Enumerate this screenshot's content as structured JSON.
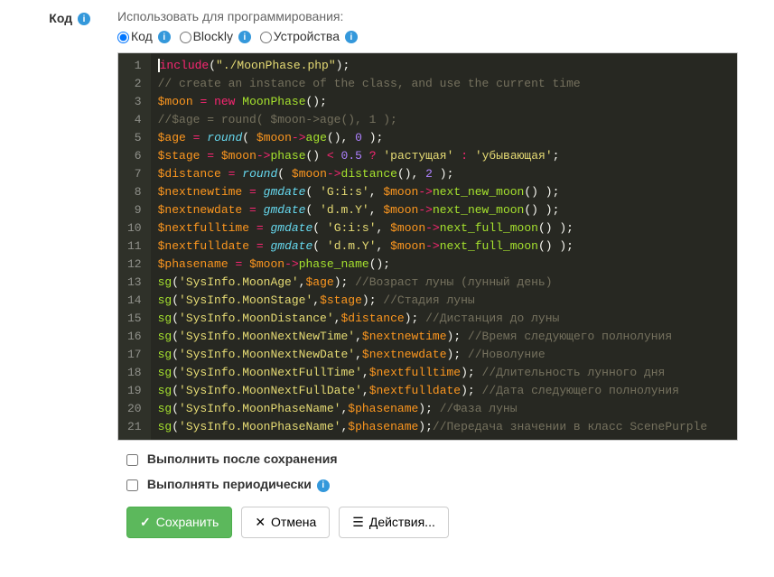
{
  "label": "Код",
  "hint": "Использовать для программирования:",
  "radios": {
    "code": "Код",
    "blockly": "Blockly",
    "devices": "Устройства"
  },
  "code_lines": [
    [
      [
        "k-red",
        "include"
      ],
      [
        "k-white",
        "("
      ],
      [
        "k-yellow",
        "\"./MoonPhase.php\""
      ],
      [
        "k-white",
        ");"
      ]
    ],
    [
      [
        "k-comment",
        "// create an instance of the class, and use the current time"
      ]
    ],
    [
      [
        "k-orange",
        "$moon"
      ],
      [
        "k-white",
        " "
      ],
      [
        "k-red",
        "="
      ],
      [
        "k-white",
        " "
      ],
      [
        "k-red",
        "new"
      ],
      [
        "k-white",
        " "
      ],
      [
        "k-green",
        "MoonPhase"
      ],
      [
        "k-white",
        "();"
      ]
    ],
    [
      [
        "k-comment",
        "//$age = round( $moon->age(), 1 );"
      ]
    ],
    [
      [
        "k-orange",
        "$age"
      ],
      [
        "k-white",
        " "
      ],
      [
        "k-red",
        "="
      ],
      [
        "k-white",
        " "
      ],
      [
        "k-blue",
        "round"
      ],
      [
        "k-white",
        "( "
      ],
      [
        "k-orange",
        "$moon"
      ],
      [
        "k-red",
        "->"
      ],
      [
        "k-green",
        "age"
      ],
      [
        "k-white",
        "(), "
      ],
      [
        "k-purple",
        "0"
      ],
      [
        "k-white",
        " );"
      ]
    ],
    [
      [
        "k-orange",
        "$stage"
      ],
      [
        "k-white",
        " "
      ],
      [
        "k-red",
        "="
      ],
      [
        "k-white",
        " "
      ],
      [
        "k-orange",
        "$moon"
      ],
      [
        "k-red",
        "->"
      ],
      [
        "k-green",
        "phase"
      ],
      [
        "k-white",
        "() "
      ],
      [
        "k-red",
        "<"
      ],
      [
        "k-white",
        " "
      ],
      [
        "k-purple",
        "0.5"
      ],
      [
        "k-white",
        " "
      ],
      [
        "k-red",
        "?"
      ],
      [
        "k-white",
        " "
      ],
      [
        "k-yellow",
        "'растущая'"
      ],
      [
        "k-white",
        " "
      ],
      [
        "k-red",
        ":"
      ],
      [
        "k-white",
        " "
      ],
      [
        "k-yellow",
        "'убывающая'"
      ],
      [
        "k-white",
        ";"
      ]
    ],
    [
      [
        "k-orange",
        "$distance"
      ],
      [
        "k-white",
        " "
      ],
      [
        "k-red",
        "="
      ],
      [
        "k-white",
        " "
      ],
      [
        "k-blue",
        "round"
      ],
      [
        "k-white",
        "( "
      ],
      [
        "k-orange",
        "$moon"
      ],
      [
        "k-red",
        "->"
      ],
      [
        "k-green",
        "distance"
      ],
      [
        "k-white",
        "(), "
      ],
      [
        "k-purple",
        "2"
      ],
      [
        "k-white",
        " );"
      ]
    ],
    [
      [
        "k-orange",
        "$nextnewtime"
      ],
      [
        "k-white",
        " "
      ],
      [
        "k-red",
        "="
      ],
      [
        "k-white",
        " "
      ],
      [
        "k-blue",
        "gmdate"
      ],
      [
        "k-white",
        "( "
      ],
      [
        "k-yellow",
        "'G:i:s'"
      ],
      [
        "k-white",
        ", "
      ],
      [
        "k-orange",
        "$moon"
      ],
      [
        "k-red",
        "->"
      ],
      [
        "k-green",
        "next_new_moon"
      ],
      [
        "k-white",
        "() );"
      ]
    ],
    [
      [
        "k-orange",
        "$nextnewdate"
      ],
      [
        "k-white",
        " "
      ],
      [
        "k-red",
        "="
      ],
      [
        "k-white",
        " "
      ],
      [
        "k-blue",
        "gmdate"
      ],
      [
        "k-white",
        "( "
      ],
      [
        "k-yellow",
        "'d.m.Y'"
      ],
      [
        "k-white",
        ", "
      ],
      [
        "k-orange",
        "$moon"
      ],
      [
        "k-red",
        "->"
      ],
      [
        "k-green",
        "next_new_moon"
      ],
      [
        "k-white",
        "() );"
      ]
    ],
    [
      [
        "k-orange",
        "$nextfulltime"
      ],
      [
        "k-white",
        " "
      ],
      [
        "k-red",
        "="
      ],
      [
        "k-white",
        " "
      ],
      [
        "k-blue",
        "gmdate"
      ],
      [
        "k-white",
        "( "
      ],
      [
        "k-yellow",
        "'G:i:s'"
      ],
      [
        "k-white",
        ", "
      ],
      [
        "k-orange",
        "$moon"
      ],
      [
        "k-red",
        "->"
      ],
      [
        "k-green",
        "next_full_moon"
      ],
      [
        "k-white",
        "() );"
      ]
    ],
    [
      [
        "k-orange",
        "$nextfulldate"
      ],
      [
        "k-white",
        " "
      ],
      [
        "k-red",
        "="
      ],
      [
        "k-white",
        " "
      ],
      [
        "k-blue",
        "gmdate"
      ],
      [
        "k-white",
        "( "
      ],
      [
        "k-yellow",
        "'d.m.Y'"
      ],
      [
        "k-white",
        ", "
      ],
      [
        "k-orange",
        "$moon"
      ],
      [
        "k-red",
        "->"
      ],
      [
        "k-green",
        "next_full_moon"
      ],
      [
        "k-white",
        "() );"
      ]
    ],
    [
      [
        "k-orange",
        "$phasename"
      ],
      [
        "k-white",
        " "
      ],
      [
        "k-red",
        "="
      ],
      [
        "k-white",
        " "
      ],
      [
        "k-orange",
        "$moon"
      ],
      [
        "k-red",
        "->"
      ],
      [
        "k-green",
        "phase_name"
      ],
      [
        "k-white",
        "();"
      ]
    ],
    [
      [
        "k-green",
        "sg"
      ],
      [
        "k-white",
        "("
      ],
      [
        "k-yellow",
        "'SysInfo.MoonAge'"
      ],
      [
        "k-white",
        ","
      ],
      [
        "k-orange",
        "$age"
      ],
      [
        "k-white",
        "); "
      ],
      [
        "k-comment",
        "//Возраст луны (лунный день)"
      ]
    ],
    [
      [
        "k-green",
        "sg"
      ],
      [
        "k-white",
        "("
      ],
      [
        "k-yellow",
        "'SysInfo.MoonStage'"
      ],
      [
        "k-white",
        ","
      ],
      [
        "k-orange",
        "$stage"
      ],
      [
        "k-white",
        "); "
      ],
      [
        "k-comment",
        "//Стадия луны"
      ]
    ],
    [
      [
        "k-green",
        "sg"
      ],
      [
        "k-white",
        "("
      ],
      [
        "k-yellow",
        "'SysInfo.MoonDistance'"
      ],
      [
        "k-white",
        ","
      ],
      [
        "k-orange",
        "$distance"
      ],
      [
        "k-white",
        "); "
      ],
      [
        "k-comment",
        "//Дистанция до луны"
      ]
    ],
    [
      [
        "k-green",
        "sg"
      ],
      [
        "k-white",
        "("
      ],
      [
        "k-yellow",
        "'SysInfo.MoonNextNewTime'"
      ],
      [
        "k-white",
        ","
      ],
      [
        "k-orange",
        "$nextnewtime"
      ],
      [
        "k-white",
        "); "
      ],
      [
        "k-comment",
        "//Время следующего полнолуния"
      ]
    ],
    [
      [
        "k-green",
        "sg"
      ],
      [
        "k-white",
        "("
      ],
      [
        "k-yellow",
        "'SysInfo.MoonNextNewDate'"
      ],
      [
        "k-white",
        ","
      ],
      [
        "k-orange",
        "$nextnewdate"
      ],
      [
        "k-white",
        "); "
      ],
      [
        "k-comment",
        "//Новолуние"
      ]
    ],
    [
      [
        "k-green",
        "sg"
      ],
      [
        "k-white",
        "("
      ],
      [
        "k-yellow",
        "'SysInfo.MoonNextFullTime'"
      ],
      [
        "k-white",
        ","
      ],
      [
        "k-orange",
        "$nextfulltime"
      ],
      [
        "k-white",
        "); "
      ],
      [
        "k-comment",
        "//Длительность лунного дня"
      ]
    ],
    [
      [
        "k-green",
        "sg"
      ],
      [
        "k-white",
        "("
      ],
      [
        "k-yellow",
        "'SysInfo.MoonNextFullDate'"
      ],
      [
        "k-white",
        ","
      ],
      [
        "k-orange",
        "$nextfulldate"
      ],
      [
        "k-white",
        "); "
      ],
      [
        "k-comment",
        "//Дата следующего полнолуния"
      ]
    ],
    [
      [
        "k-green",
        "sg"
      ],
      [
        "k-white",
        "("
      ],
      [
        "k-yellow",
        "'SysInfo.MoonPhaseName'"
      ],
      [
        "k-white",
        ","
      ],
      [
        "k-orange",
        "$phasename"
      ],
      [
        "k-white",
        "); "
      ],
      [
        "k-comment",
        "//Фаза луны"
      ]
    ],
    [
      [
        "k-green",
        "sg"
      ],
      [
        "k-white",
        "("
      ],
      [
        "k-yellow",
        "'SysInfo.MoonPhaseName'"
      ],
      [
        "k-white",
        ","
      ],
      [
        "k-orange",
        "$phasename"
      ],
      [
        "k-white",
        ");"
      ],
      [
        "k-comment",
        "//Передача значении в класс ScenePurple"
      ]
    ]
  ],
  "checkboxes": {
    "run_after_save": "Выполнить после сохранения",
    "run_periodically": "Выполнять периодически"
  },
  "buttons": {
    "save": "Сохранить",
    "cancel": "Отмена",
    "actions": "Действия..."
  }
}
